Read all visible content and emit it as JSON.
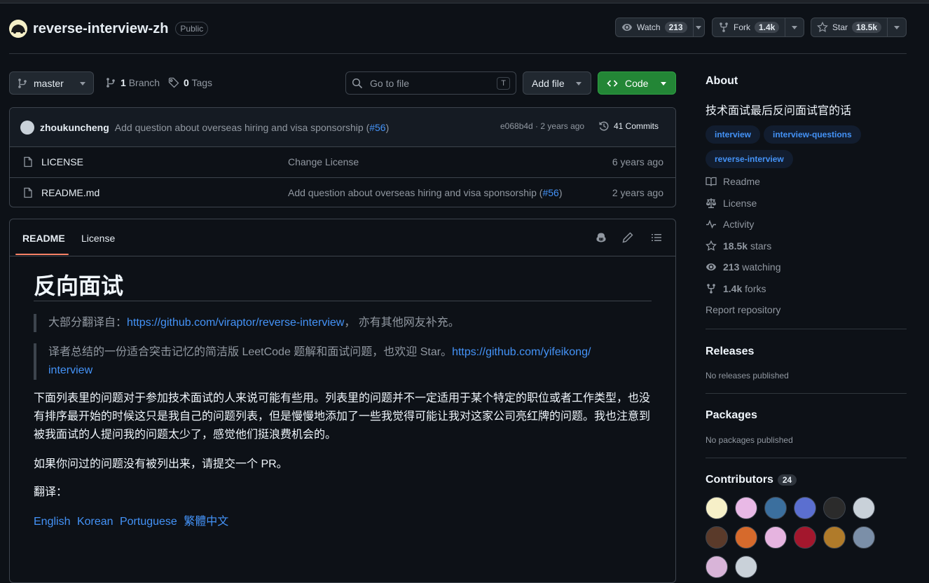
{
  "repo": {
    "name": "reverse-interview-zh",
    "visibility": "Public"
  },
  "actions": {
    "watch": {
      "label": "Watch",
      "count": "213"
    },
    "fork": {
      "label": "Fork",
      "count": "1.4k"
    },
    "star": {
      "label": "Star",
      "count": "18.5k"
    }
  },
  "toolbar": {
    "branch": "master",
    "branches_count": "1",
    "branches_label": "Branch",
    "tags_count": "0",
    "tags_label": "Tags",
    "search_placeholder": "Go to file",
    "search_shortcut": "T",
    "add_file": "Add file",
    "code": "Code"
  },
  "latest_commit": {
    "author": "zhoukuncheng",
    "message": "Add question about overseas hiring and visa sponsorship (",
    "pr": "#56",
    "message_end": ")",
    "hash_time": "e068b4d · 2 years ago",
    "commits": "41 Commits"
  },
  "files": [
    {
      "name": "LICENSE",
      "message": "Change License",
      "pr": "",
      "message_end": "",
      "time": "6 years ago"
    },
    {
      "name": "README.md",
      "message": "Add question about overseas hiring and visa sponsorship (",
      "pr": "#56",
      "message_end": ")",
      "time": "2 years ago"
    }
  ],
  "readme": {
    "tabs": [
      "README",
      "License"
    ],
    "title": "反向面试",
    "quote1_prefix": "大部分翻译自：",
    "quote1_link": "https://github.com/viraptor/reverse-interview",
    "quote1_suffix": "， 亦有其他网友补充。",
    "quote2_prefix": "译者总结的一份适合突击记忆的简洁版 LeetCode 题解和面试问题，也欢迎 Star。",
    "quote2_link1": "https://github.com/yifeikong/",
    "quote2_link2": "interview",
    "para1": "下面列表里的问题对于参加技术面试的人来说可能有些用。列表里的问题并不一定适用于某个特定的职位或者工作类型，也没有排序最开始的时候这只是我自己的问题列表，但是慢慢地添加了一些我觉得可能让我对这家公司亮红牌的问题。我也注意到被我面试的人提问我的问题太少了，感觉他们挺浪费机会的。",
    "para2": "如果你问过的问题没有被列出来，请提交一个 PR。",
    "para3": "翻译：",
    "languages": [
      "English",
      "Korean",
      "Portuguese",
      "繁體中文"
    ]
  },
  "about": {
    "heading": "About",
    "description": "技术面试最后反问面试官的话",
    "topics": [
      "interview",
      "interview-questions",
      "reverse-interview"
    ],
    "links": [
      {
        "icon": "book-icon",
        "label": "Readme"
      },
      {
        "icon": "law-icon",
        "label": "License"
      },
      {
        "icon": "pulse-icon",
        "label": "Activity"
      },
      {
        "icon": "star-icon",
        "count": "18.5k",
        "label": "stars"
      },
      {
        "icon": "eye-icon",
        "count": "213",
        "label": "watching"
      },
      {
        "icon": "fork-icon",
        "count": "1.4k",
        "label": "forks"
      }
    ],
    "report": "Report repository"
  },
  "releases": {
    "heading": "Releases",
    "note": "No releases published"
  },
  "packages": {
    "heading": "Packages",
    "note": "No packages published"
  },
  "contributors": {
    "heading": "Contributors",
    "count": "24"
  },
  "colors": {
    "bg": "#0d1117",
    "accent": "#4493f8",
    "code_button": "#238636",
    "tab_underline": "#f78166"
  }
}
